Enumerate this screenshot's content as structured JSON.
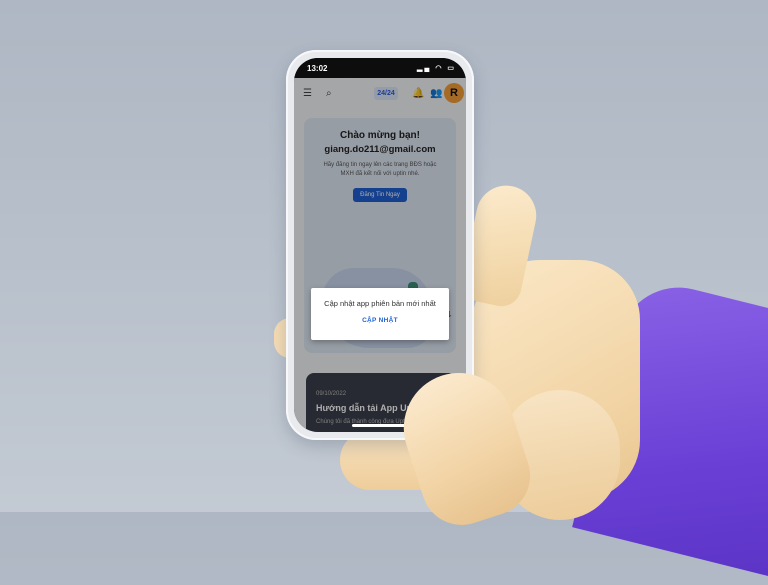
{
  "status": {
    "time": "13:02",
    "icons": "▂▄ ◠ ▭"
  },
  "topbar": {
    "menu_icon": "☰",
    "search_icon": "⌕",
    "badge": "24/24",
    "bell_icon": "🔔",
    "user_icon": "👥",
    "avatar_letter": "R"
  },
  "welcome": {
    "greeting": "Chào mừng bạn!",
    "email": "giang.do211@gmail.com",
    "hint": "Hãy đăng tin ngay lên các trang BĐS hoặc MXH đã kết nối với uptin nhé.",
    "post_button": "Đăng Tin Ngay"
  },
  "filter_icon": "⇅",
  "news": {
    "date": "09/10/2022",
    "title": "Hướng dẫn tải App Uptin t",
    "excerpt": "Chúng tôi đã thành công đưa Uptin"
  },
  "dialog": {
    "message": "Cập nhật app phiên bản mới nhất",
    "button": "CẬP NHẬT"
  },
  "colors": {
    "accent": "#1f62d2",
    "sleeve": "#6a3fd6",
    "skin": "#f1d3a3",
    "background": "#b3bcc8"
  }
}
